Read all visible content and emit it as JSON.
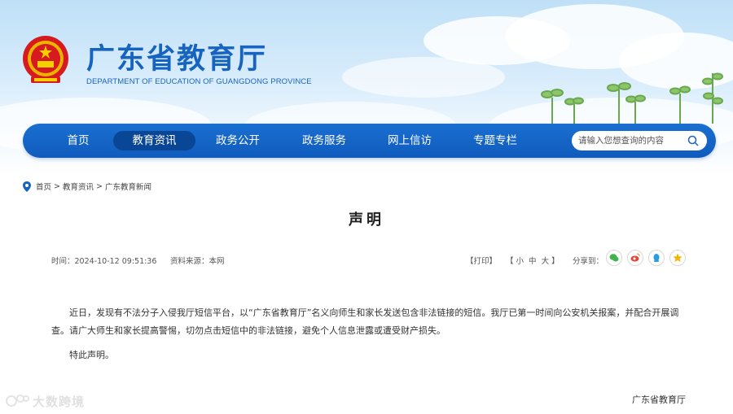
{
  "header": {
    "title": "广东省教育厅",
    "subtitle": "DEPARTMENT OF EDUCATION OF GUANGDONG PROVINCE",
    "emblem_icon": "national-emblem-icon"
  },
  "nav": {
    "items": [
      {
        "label": "首页",
        "active": false
      },
      {
        "label": "教育资讯",
        "active": true
      },
      {
        "label": "政务公开",
        "active": false
      },
      {
        "label": "政务服务",
        "active": false
      },
      {
        "label": "网上信访",
        "active": false
      },
      {
        "label": "专题专栏",
        "active": false
      }
    ],
    "search_placeholder": "请输入您想查询的内容",
    "search_icon": "search-icon"
  },
  "breadcrumb": [
    "首页",
    "教育资讯",
    "广东教育新闻"
  ],
  "article": {
    "title": "声明",
    "time_label": "时间：2024-10-12 09:51:36",
    "source_label": "资料来源：本网",
    "print_label": "【打印】",
    "size_label": "【 小  中  大 】",
    "share_label": "分享到：",
    "share_icons": [
      "wechat-icon",
      "weibo-icon",
      "qq-icon",
      "qzone-icon"
    ],
    "paragraphs": [
      "近日，发现有不法分子入侵我厅短信平台，以“广东省教育厅”名义向师生和家长发送包含非法链接的短信。我厅已第一时间向公安机关报案，并配合开展调查。请广大师生和家长提高警惕，切勿点击短信中的非法链接，避免个人信息泄露或遭受财产损失。",
      "特此声明。"
    ],
    "signature": "广东省教育厅"
  },
  "watermark": {
    "text": "大数跨境"
  },
  "colors": {
    "brand_blue": "#1764c0",
    "nav_blue": "#1a6fd0",
    "nav_active": "#0a4696"
  }
}
